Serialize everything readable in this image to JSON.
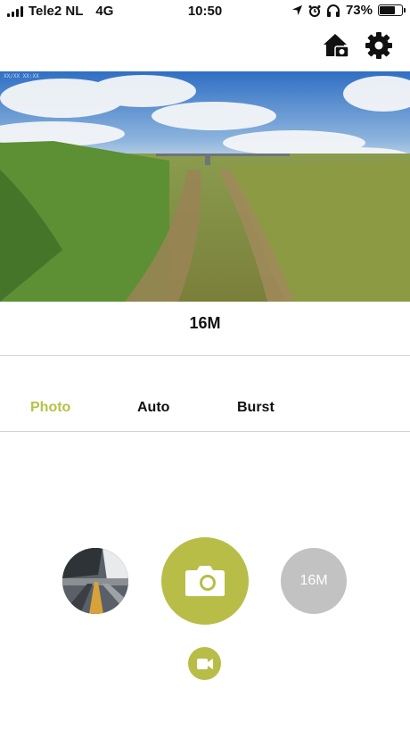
{
  "status_bar": {
    "carrier": "Tele2 NL",
    "network": "4G",
    "time": "10:50",
    "battery_text": "73%",
    "battery_level": 0.73
  },
  "toolbar": {
    "icons": [
      "camera-home-icon",
      "gear-icon"
    ]
  },
  "preview": {
    "overlay_text": "XX/XX XX:XX"
  },
  "resolution_label": "16M",
  "modes": {
    "tabs": [
      {
        "label": "Photo",
        "active": true
      },
      {
        "label": "Auto",
        "active": false
      },
      {
        "label": "Burst",
        "active": false
      }
    ]
  },
  "controls": {
    "resolution_button": "16M",
    "accent_color": "#b8bd48"
  }
}
